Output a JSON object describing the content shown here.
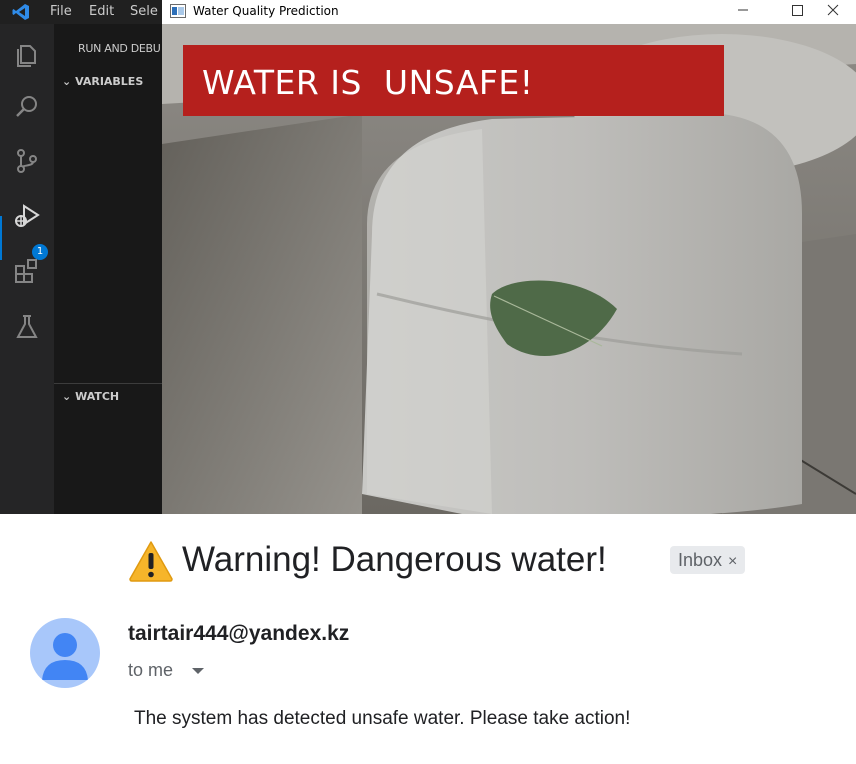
{
  "vscode": {
    "menu": [
      "File",
      "Edit",
      "Sele"
    ],
    "sidebar_title": "RUN AND DEBU",
    "sections": {
      "variables": "VARIABLES",
      "watch": "WATCH"
    },
    "debug_badge": "1",
    "activity_icons": [
      "explorer-icon",
      "search-icon",
      "source-control-icon",
      "run-debug-icon",
      "extensions-icon",
      "testing-icon"
    ]
  },
  "prediction_window": {
    "title": "Water Quality Prediction",
    "alert_text": "WATER IS  UNSAFE!",
    "alert_color": "#b5201d"
  },
  "email": {
    "warning_icon": "warning-icon",
    "subject": "Warning! Dangerous water!",
    "label_chip": "Inbox",
    "label_close": "×",
    "sender": "tairtair444@yandex.kz",
    "recipient": "to me",
    "body": "The system has detected unsafe water. Please take action!"
  }
}
